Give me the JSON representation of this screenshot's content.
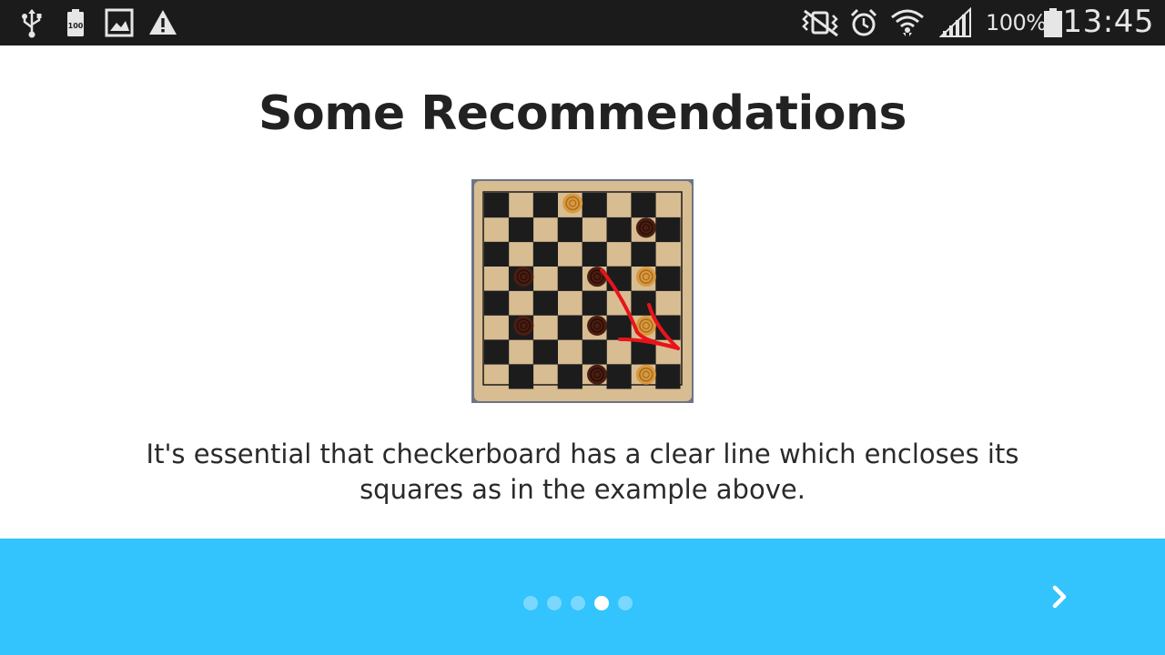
{
  "status_bar": {
    "left_icons": [
      "usb-icon",
      "battery-100-notification-icon",
      "image-icon",
      "warning-icon"
    ],
    "right_icons": [
      "vibrate-mode-icon",
      "alarm-icon",
      "wifi-icon",
      "cell-signal-icon",
      "battery-icon"
    ],
    "battery_percent": "100%",
    "time": "13:45"
  },
  "page": {
    "title": "Some Recommendations",
    "image_alt_icon": "checkerboard-image",
    "description": "It's essential that checkerboard has a clear line which encloses its squares as in the example above."
  },
  "bottom_bar": {
    "background_color": "#33c3fd",
    "pager": {
      "total": 5,
      "active_index": 3
    },
    "next_icon": "chevron-right-icon"
  },
  "colors": {
    "status_bar_bg": "#1b1b1b",
    "title_text": "#222222",
    "annotation_arrow": "#e8141b"
  }
}
